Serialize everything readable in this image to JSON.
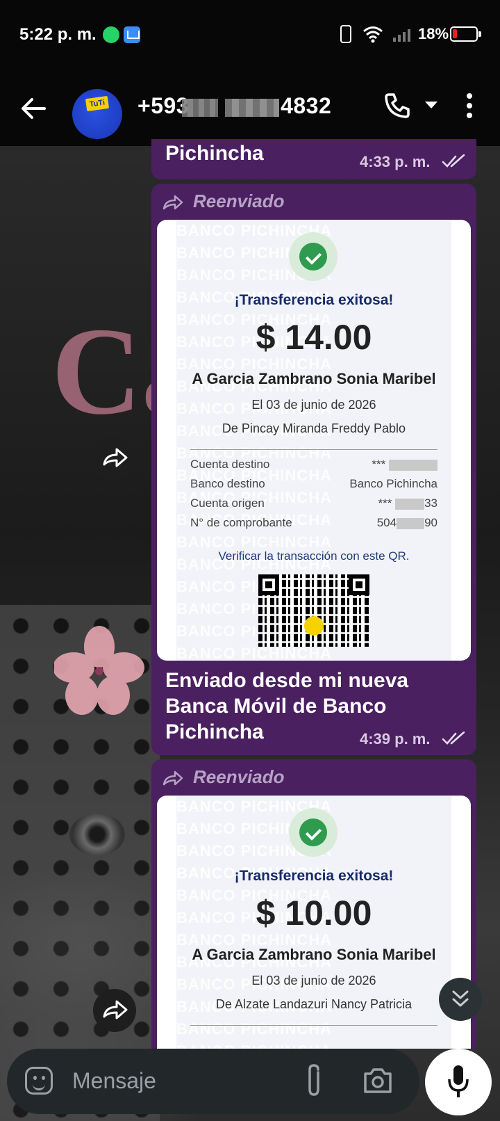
{
  "status_bar": {
    "time": "5:22 p. m.",
    "battery": "18%",
    "icons": [
      "whatsapp-icon",
      "mail-icon",
      "vibrate-icon",
      "wifi-icon",
      "signal-icon",
      "battery-icon"
    ]
  },
  "header": {
    "contact_prefix": "+593",
    "contact_suffix": "4832",
    "avatar_text": "TuTi",
    "icons": [
      "back-arrow-icon",
      "phone-icon",
      "chevron-down-icon",
      "more-vert-icon"
    ]
  },
  "chat": {
    "background_text": "Ca",
    "messages": [
      {
        "text": "Pichincha",
        "time": "4:33 p. m."
      },
      {
        "forwarded_label": "Reenviado",
        "receipt": {
          "watermark": "BANCO PICHINCHA",
          "title": "¡Transferencia exitosa!",
          "amount": "$ 14.00",
          "to": "A Garcia Zambrano Sonia Maribel",
          "date": "El 03 de junio de 2026",
          "from": "De Pincay Miranda Freddy Pablo",
          "rows": [
            {
              "key": "Cuenta destino",
              "value_prefix": "***",
              "value_suffix": ""
            },
            {
              "key": "Banco destino",
              "value_prefix": "Banco Pichincha",
              "value_suffix": ""
            },
            {
              "key": "Cuenta origen",
              "value_prefix": "***",
              "value_suffix": "33"
            },
            {
              "key": "N° de comprobante",
              "value_prefix": "504",
              "value_suffix": "90"
            }
          ],
          "verify": "Verificar la transacción con este QR."
        },
        "caption": [
          "Enviado desde mi nueva",
          "Banca Móvil de Banco",
          "Pichincha"
        ],
        "time": "4:39 p. m."
      },
      {
        "forwarded_label": "Reenviado",
        "receipt": {
          "watermark": "BANCO PICHINCHA",
          "title": "¡Transferencia exitosa!",
          "amount": "$ 10.00",
          "to": "A Garcia Zambrano Sonia Maribel",
          "date": "El 03 de junio de 2026",
          "from": "De Alzate Landazuri Nancy Patricia"
        }
      }
    ]
  },
  "composer": {
    "placeholder": "Mensaje",
    "icons": [
      "emoji-icon",
      "attach-icon",
      "camera-icon",
      "mic-icon"
    ]
  },
  "colors": {
    "bubble": "#4a2060",
    "bar": "#070707",
    "accent_check": "#2e9b4e"
  }
}
